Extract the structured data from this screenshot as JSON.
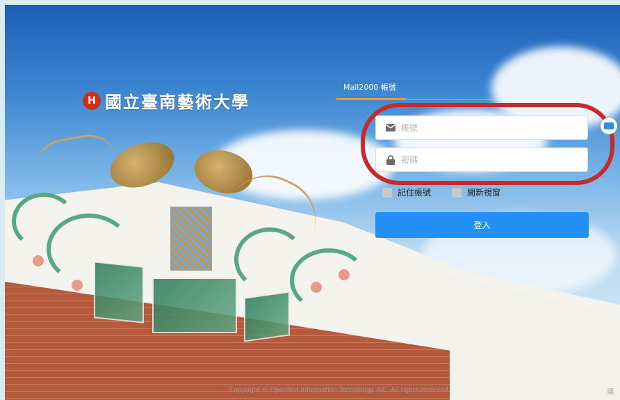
{
  "logo": {
    "mark_text": "H",
    "name": "國立臺南藝術大學"
  },
  "login": {
    "tab_label": "Mail2000 帳號",
    "account_placeholder": "帳號",
    "password_placeholder": "密碼",
    "remember_label": "記住帳號",
    "new_window_label": "開新視窗",
    "submit_label": "登入",
    "account_icon": "envelope-icon",
    "password_icon": "lock-icon",
    "keyboard_icon": "keyboard-icon"
  },
  "footer": {
    "copyright": "Copyright © Openfind Information Technology INC. All rights reserved.",
    "corner_text": "隱"
  },
  "colors": {
    "accent": "#2390f3",
    "tab_underline": "#f29b2f",
    "highlight": "#c62a2a"
  }
}
